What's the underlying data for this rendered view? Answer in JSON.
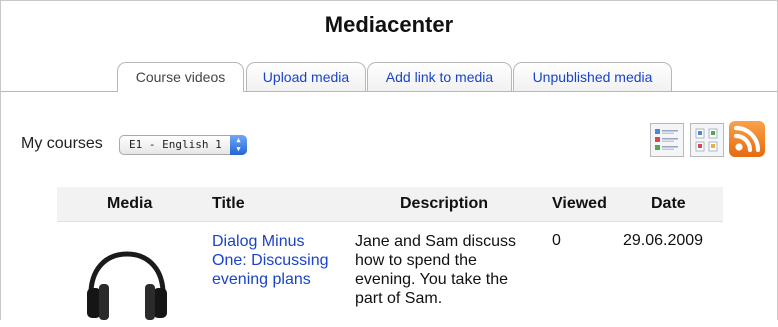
{
  "page": {
    "title": "Mediacenter"
  },
  "tabs": [
    {
      "label": "Course videos",
      "active": true
    },
    {
      "label": "Upload media",
      "active": false
    },
    {
      "label": "Add link to media",
      "active": false
    },
    {
      "label": "Unpublished media",
      "active": false
    }
  ],
  "filter": {
    "label": "My courses",
    "selected": "E1 - English 1"
  },
  "toolbar": {
    "icons": [
      "list-view-icon",
      "grid-view-icon",
      "rss-feed-icon"
    ],
    "rss_color": "#f08a24"
  },
  "table": {
    "headers": [
      "Media",
      "Title",
      "Description",
      "Viewed",
      "Date"
    ],
    "rows": [
      {
        "media_icon": "headphones-icon",
        "title": "Dialog Minus One: Discussing evening plans",
        "description": "Jane and Sam discuss how to spend the evening. You take the part of Sam.",
        "viewed": "0",
        "date": "29.06.2009"
      }
    ]
  },
  "colors": {
    "link": "#1a43c8",
    "header_bg": "#f2f2f2"
  }
}
